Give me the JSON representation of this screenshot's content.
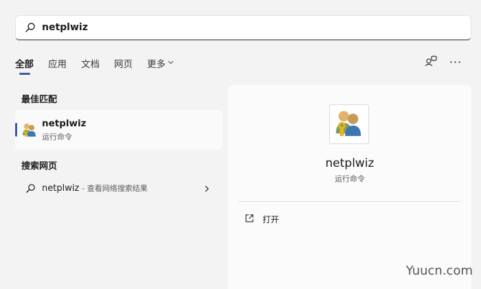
{
  "search": {
    "query": "netplwiz",
    "icon": "search-icon"
  },
  "tabs": [
    {
      "label": "全部"
    },
    {
      "label": "应用"
    },
    {
      "label": "文档"
    },
    {
      "label": "网页"
    },
    {
      "label": "更多"
    }
  ],
  "toolbar": {
    "share_icon": "account-switch-icon",
    "more_icon": "more-options-icon"
  },
  "best_match": {
    "heading": "最佳匹配",
    "name": "netplwiz",
    "subtitle": "运行命令"
  },
  "web_search": {
    "heading": "搜索网页",
    "query": "netplwiz",
    "description": "- 查看网络搜索结果"
  },
  "detail": {
    "title": "netplwiz",
    "subtitle": "运行命令",
    "actions": [
      {
        "label": "打开",
        "icon": "open-external-icon"
      }
    ]
  },
  "watermark": "Yuucn.com",
  "colors": {
    "accent": "#3b5aa5",
    "background": "#f3f3f3"
  }
}
